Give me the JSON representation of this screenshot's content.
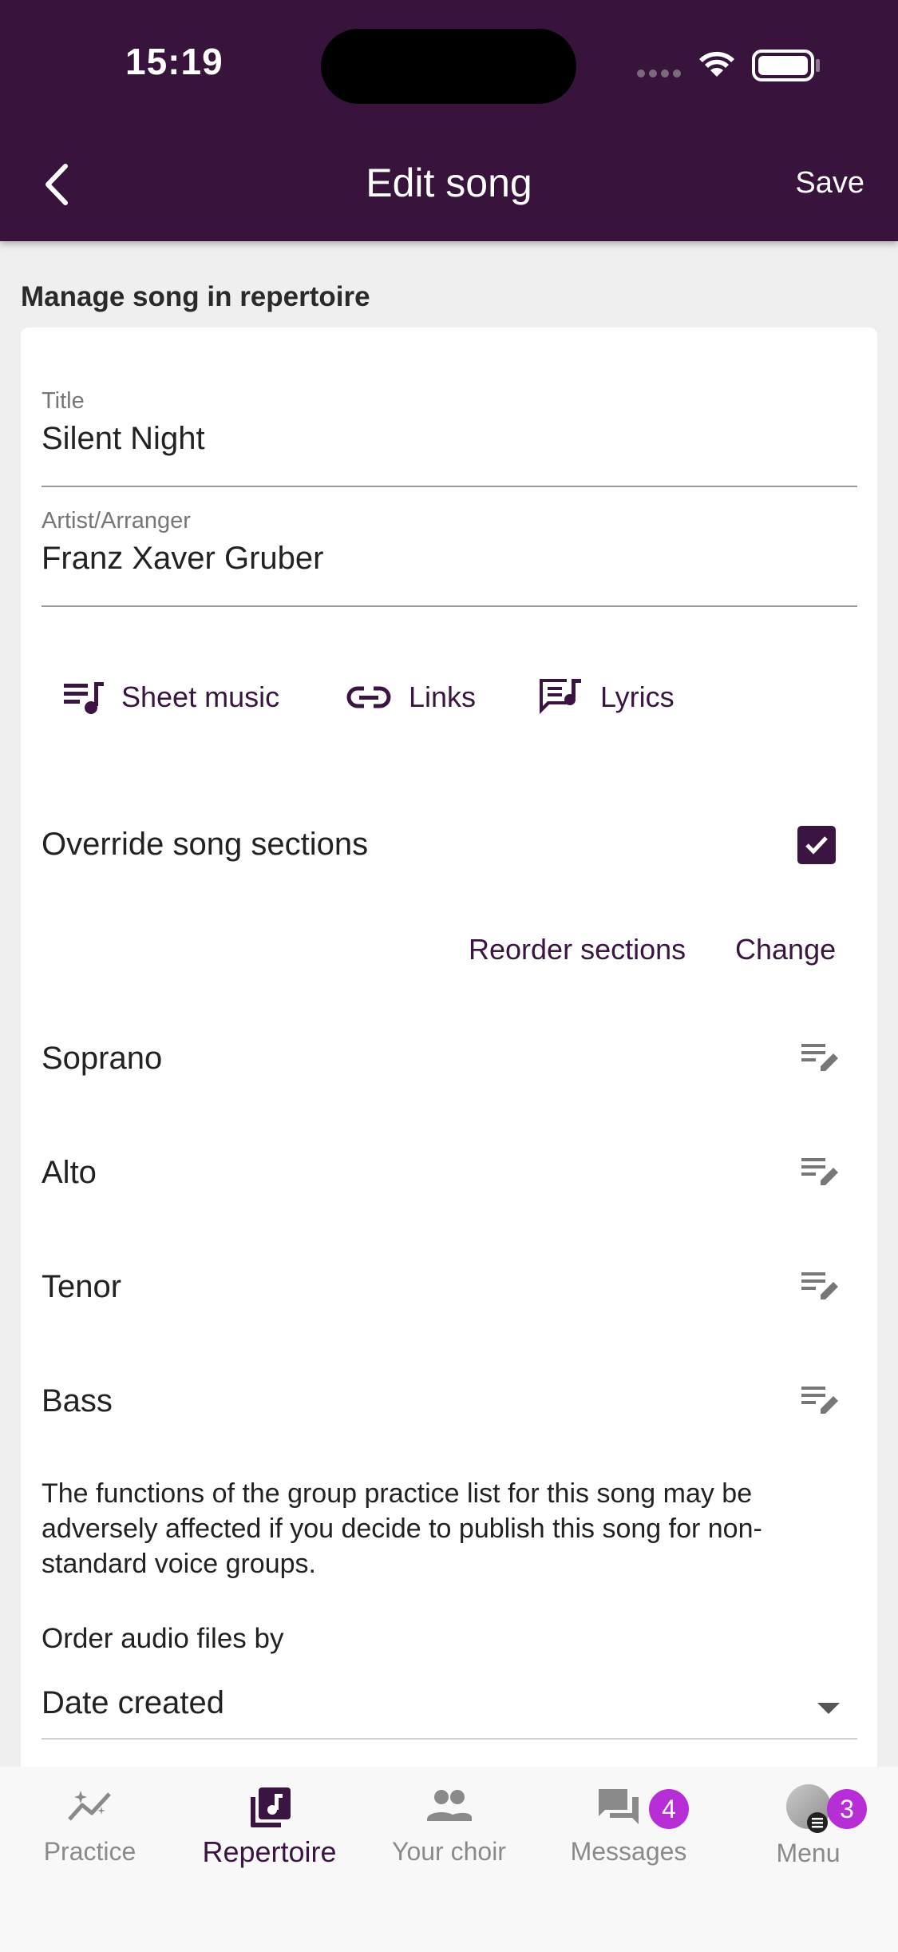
{
  "status_bar": {
    "time": "15:19"
  },
  "header": {
    "title": "Edit song",
    "save_label": "Save"
  },
  "section_heading": "Manage song in repertoire",
  "form": {
    "title": {
      "label": "Title",
      "value": "Silent Night"
    },
    "artist": {
      "label": "Artist/Arranger",
      "value": "Franz Xaver Gruber"
    }
  },
  "actions": {
    "sheet_music": "Sheet music",
    "links": "Links",
    "lyrics": "Lyrics"
  },
  "override": {
    "label": "Override song sections",
    "checked": true
  },
  "section_buttons": {
    "reorder": "Reorder sections",
    "change": "Change"
  },
  "sections": [
    {
      "name": "Soprano"
    },
    {
      "name": "Alto"
    },
    {
      "name": "Tenor"
    },
    {
      "name": "Bass"
    }
  ],
  "notice": "The functions of the group practice list for this song may be adversely affected if you decide to publish this song for non-standard voice groups.",
  "order": {
    "label": "Order audio files by",
    "value": "Date created"
  },
  "bottom_nav": {
    "items": [
      {
        "label": "Practice",
        "icon": "practice-icon"
      },
      {
        "label": "Repertoire",
        "icon": "music-library-icon",
        "active": true
      },
      {
        "label": "Your choir",
        "icon": "group-icon"
      },
      {
        "label": "Messages",
        "icon": "chat-icon",
        "badge": "4"
      },
      {
        "label": "Menu",
        "icon": "avatar",
        "badge": "3"
      }
    ]
  },
  "colors": {
    "primary": "#38143c",
    "accent": "#3a1541",
    "badge": "#b72ed6"
  }
}
